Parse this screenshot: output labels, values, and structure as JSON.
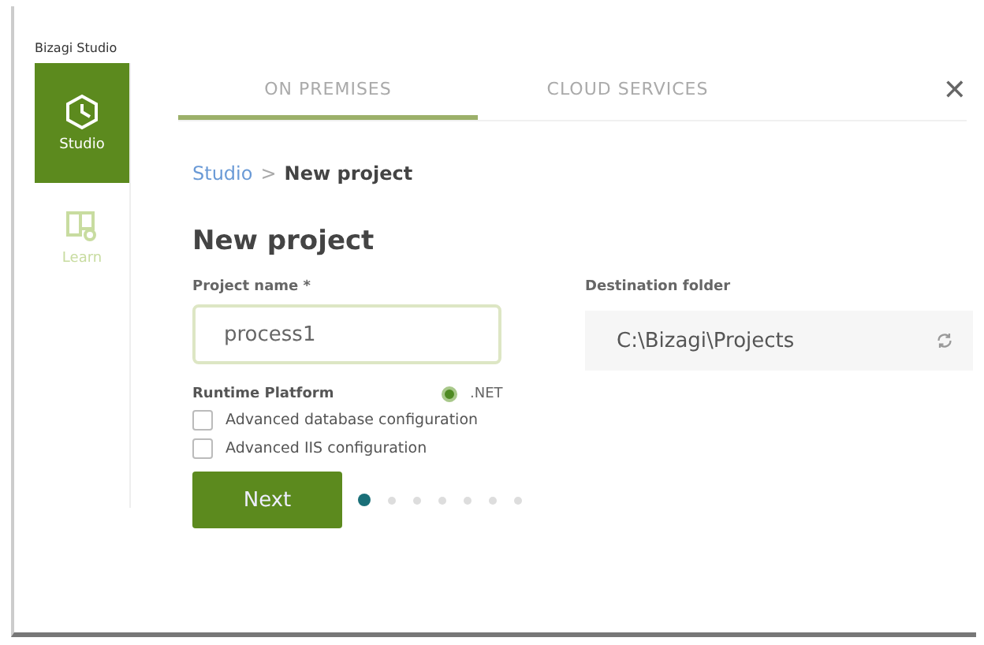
{
  "window": {
    "title": "Bizagi Studio"
  },
  "sidebar": {
    "items": [
      {
        "label": "Studio",
        "kind": "studio",
        "selected": true
      },
      {
        "label": "Learn",
        "kind": "learn",
        "selected": false
      }
    ]
  },
  "tabs": [
    {
      "label": "ON PREMISES",
      "selected": true
    },
    {
      "label": "CLOUD SERVICES",
      "selected": false
    }
  ],
  "close": "✕",
  "breadcrumb": {
    "link": "Studio",
    "separator": ">",
    "current": "New project"
  },
  "heading": "New project",
  "project_name": {
    "label": "Project name *",
    "value": "process1"
  },
  "destination": {
    "label": "Destination folder",
    "value": "C:\\Bizagi\\Projects"
  },
  "runtime": {
    "label": "Runtime Platform",
    "options": [
      {
        "label": ".NET",
        "selected": true
      }
    ]
  },
  "options": [
    {
      "label": "Advanced database configuration",
      "checked": false
    },
    {
      "label": "Advanced IIS configuration",
      "checked": false
    }
  ],
  "next_button": "Next",
  "steps": [
    {
      "selected": true
    },
    {
      "selected": false
    },
    {
      "selected": false
    },
    {
      "selected": false
    },
    {
      "selected": false
    },
    {
      "selected": false
    },
    {
      "selected": false
    }
  ]
}
